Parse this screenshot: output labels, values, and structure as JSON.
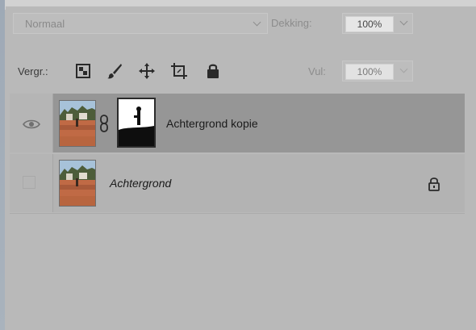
{
  "blend_mode": {
    "value": "Normaal"
  },
  "opacity": {
    "label": "Dekking:",
    "value": "100%"
  },
  "lock": {
    "label": "Vergr.:",
    "icons": [
      "lock-transparent-pixels-icon",
      "lock-image-pixels-icon",
      "lock-position-icon",
      "lock-artboard-icon",
      "lock-all-icon"
    ]
  },
  "fill": {
    "label": "Vul:",
    "value": "100%"
  },
  "layers": [
    {
      "name": "Achtergrond kopie",
      "visible": true,
      "selected": true,
      "has_mask": true,
      "linked": true,
      "locked": false
    },
    {
      "name": "Achtergrond",
      "visible": false,
      "selected": false,
      "has_mask": false,
      "linked": false,
      "locked": true
    }
  ],
  "colors": {
    "panel": "#b9b9b9",
    "selected_row": "#969696",
    "text": "#1e1e1e",
    "dim_text": "#8c8c8c"
  }
}
